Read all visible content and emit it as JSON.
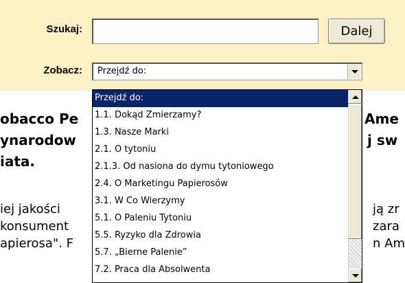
{
  "search": {
    "label": "Szukaj:",
    "input_value": "",
    "button_label": "Dalej"
  },
  "navigate": {
    "label": "Zobacz:",
    "selected_value": "Przejdź do:",
    "options": [
      "Przejdź do:",
      "1.1. Dokąd Zmierzamy?",
      "1.3. Nasze Marki",
      "2.1. O tytoniu",
      "2.1.3. Od nasiona do dymu tytoniowego",
      "2.4. O Marketingu Papierosów",
      "3.1. W Co Wierzymy",
      "5.1. O Paleniu Tytoniu",
      "5.5. Ryzyko dla Zdrowia",
      "5.7. „Bierne Palenie”",
      "7.2. Praca dla Absolwenta"
    ]
  },
  "article": {
    "heading_left": [
      "obacco Pe",
      "ynarodow",
      "iata."
    ],
    "heading_right": [
      "Ame",
      "j sw"
    ],
    "body_left": [
      "iej jakości",
      "konsument",
      "apierosa\". F"
    ],
    "body_right": [
      "ją zr",
      "zara",
      "n Am"
    ]
  },
  "colors": {
    "panel_bg": "#fcf1c4",
    "selected_bg": "#0a246a"
  }
}
